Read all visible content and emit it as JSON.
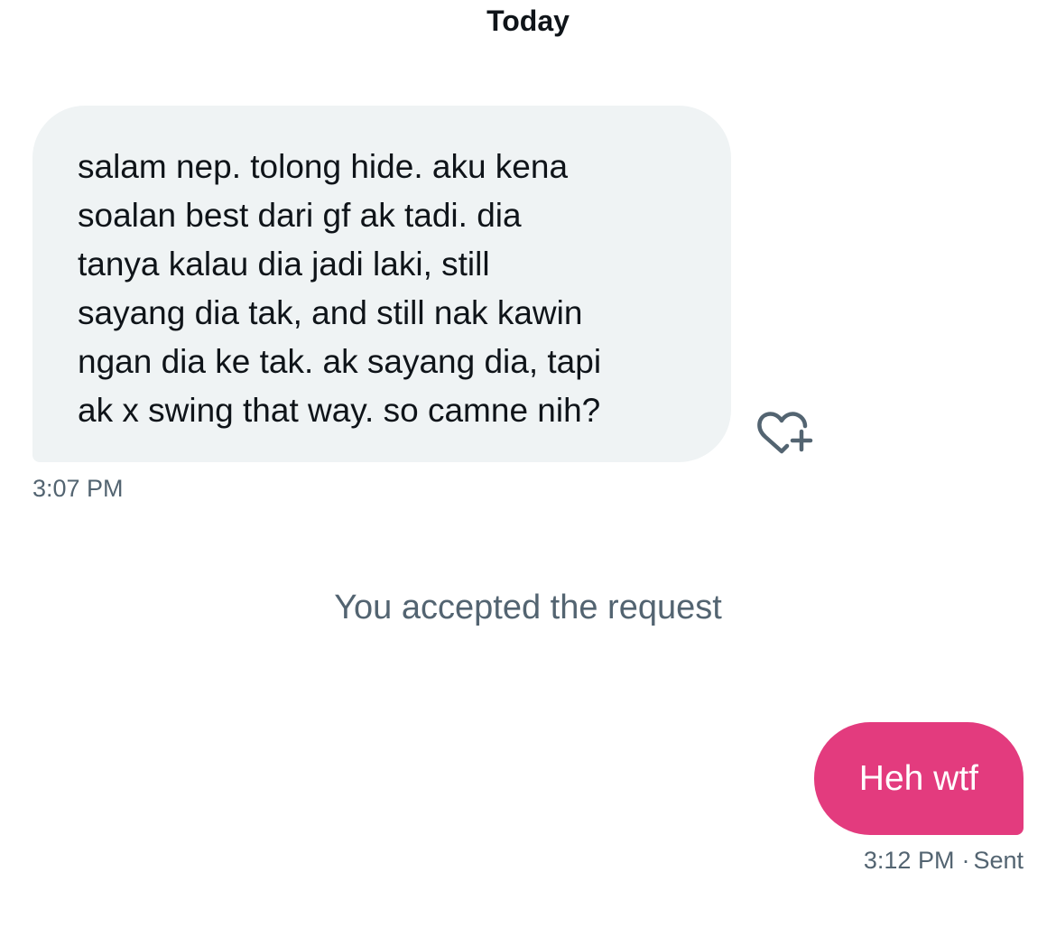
{
  "conversation": {
    "date_header": "Today",
    "incoming_message": {
      "lines": [
        "salam nep. tolong hide. aku kena",
        "soalan best dari gf ak tadi. dia",
        "tanya kalau dia jadi laki, still",
        "sayang dia tak, and still nak kawin",
        "ngan dia ke tak. ak sayang dia, tapi",
        "ak x swing that way. so camne nih?"
      ],
      "time": "3:07 PM",
      "react_icon": "heart-plus-icon"
    },
    "system_note": "You accepted the request",
    "outgoing_message": {
      "text": "Heh wtf",
      "time": "3:12 PM",
      "separator": "·",
      "status": "Sent"
    }
  },
  "colors": {
    "incoming_bubble": "#eff3f4",
    "outgoing_bubble": "#e33b7e",
    "secondary_text": "#536471",
    "primary_text": "#0f1419"
  }
}
